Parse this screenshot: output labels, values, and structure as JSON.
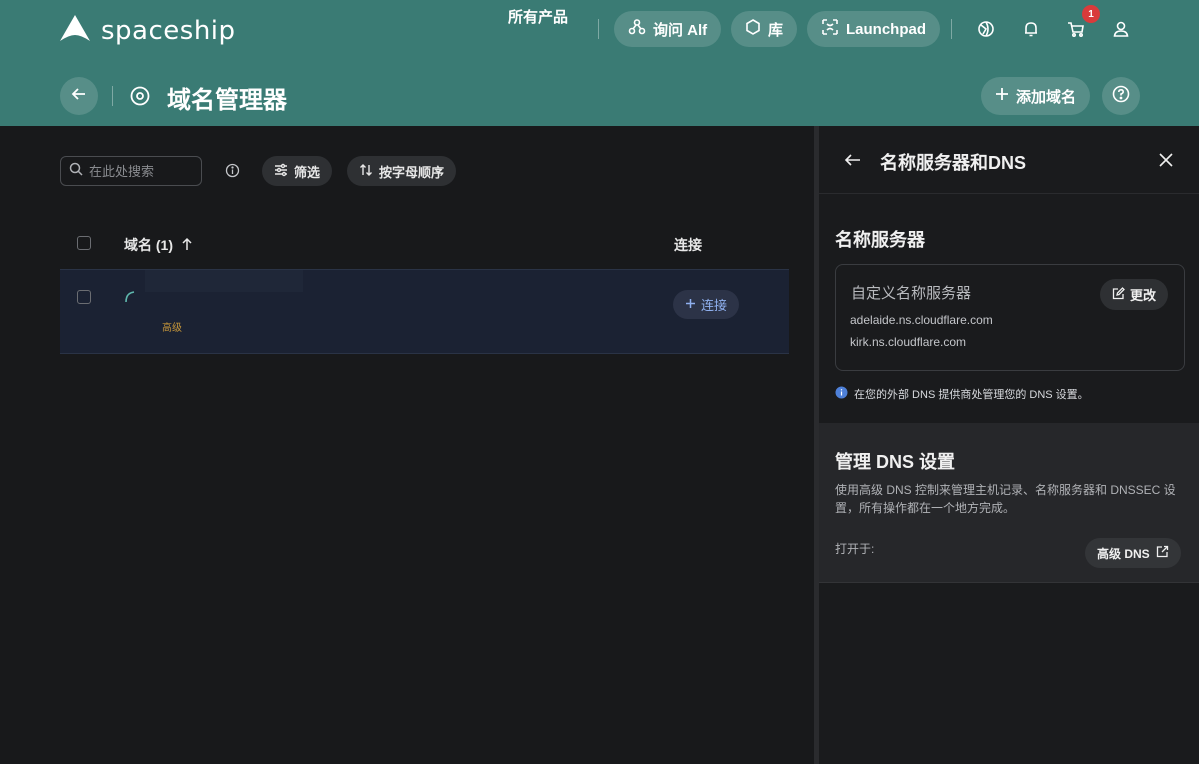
{
  "header": {
    "brand": "spaceship",
    "nav": {
      "all_products": "所有产品",
      "ask_alf": "询问 Alf",
      "library": "库",
      "launchpad": "Launchpad"
    },
    "cart_count": "1",
    "page_title": "域名管理器",
    "add_domain": "添加域名"
  },
  "toolbar": {
    "search_placeholder": "在此处搜索",
    "filter": "筛选",
    "sort": "按字母顺序"
  },
  "table": {
    "col_domain": "域名 (1)",
    "col_connect": "连接",
    "rows": [
      {
        "tag": "高级",
        "connect_label": "连接"
      }
    ]
  },
  "panel": {
    "title": "名称服务器和DNS",
    "nameservers": {
      "heading": "名称服务器",
      "label": "自定义名称服务器",
      "edit": "更改",
      "items": [
        "adelaide.ns.cloudflare.com",
        "kirk.ns.cloudflare.com"
      ],
      "note": "在您的外部 DNS 提供商处管理您的 DNS 设置。"
    },
    "dns": {
      "heading": "管理 DNS 设置",
      "description": "使用高级 DNS 控制来管理主机记录、名称服务器和 DNSSEC 设置，所有操作都在一个地方完成。",
      "open_in": "打开于:",
      "advanced_dns": "高级 DNS"
    }
  },
  "colors": {
    "header_bg": "#3a7b74",
    "page_bg": "#18191b",
    "accent_link": "#8fb0ef",
    "badge": "#d93b3b",
    "premium": "#c4953a"
  }
}
